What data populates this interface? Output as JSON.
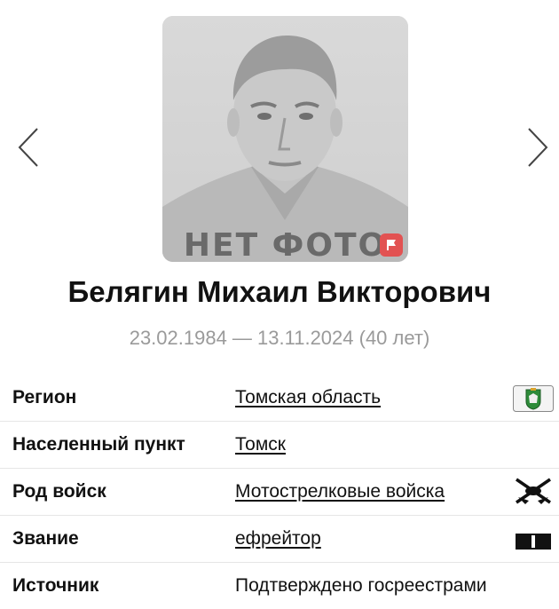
{
  "photo": {
    "placeholder_text": "НЕТ ФОТО"
  },
  "person": {
    "name": "Белягин Михаил Викторович",
    "dates": "23.02.1984 — 13.11.2024 (40 лет)"
  },
  "details": [
    {
      "label": "Регион",
      "value": "Томская область",
      "icon": "tomsk-coat-of-arms-icon"
    },
    {
      "label": "Населенный пункт",
      "value": "Томск"
    },
    {
      "label": "Род войск",
      "value": "Мотострелковые войска",
      "icon": "motorized-rifle-emblem-icon"
    },
    {
      "label": "Звание",
      "value": "ефрейтор",
      "icon": "corporal-rank-stripe-icon"
    },
    {
      "label": "Источник",
      "value": "Подтверждено госреестрами"
    }
  ],
  "colors": {
    "flag_button": "#e25252",
    "dates_text": "#9a9a9a"
  }
}
